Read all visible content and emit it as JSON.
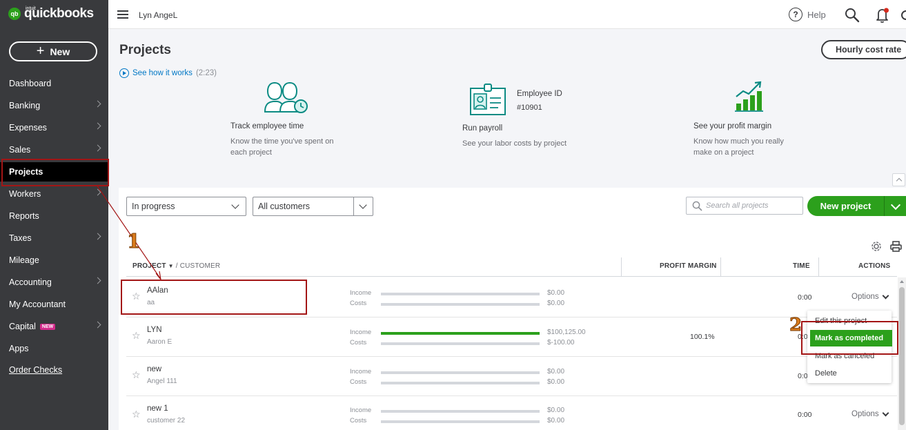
{
  "brand": {
    "intuit": "intuit",
    "name": "quickbooks",
    "mark": "qb"
  },
  "sidebar": {
    "new_label": "New",
    "items": [
      {
        "label": "Dashboard",
        "chevron": false
      },
      {
        "label": "Banking",
        "chevron": true
      },
      {
        "label": "Expenses",
        "chevron": true
      },
      {
        "label": "Sales",
        "chevron": true
      },
      {
        "label": "Projects",
        "chevron": false,
        "active": true
      },
      {
        "label": "Workers",
        "chevron": true
      },
      {
        "label": "Reports",
        "chevron": false
      },
      {
        "label": "Taxes",
        "chevron": true
      },
      {
        "label": "Mileage",
        "chevron": false
      },
      {
        "label": "Accounting",
        "chevron": true
      },
      {
        "label": "My Accountant",
        "chevron": false
      },
      {
        "label": "Capital",
        "chevron": true,
        "badge": "NEW"
      },
      {
        "label": "Apps",
        "chevron": false
      },
      {
        "label": "Order Checks",
        "chevron": false
      }
    ]
  },
  "header": {
    "company": "Lyn AngeL",
    "help": "Help"
  },
  "page": {
    "title": "Projects",
    "hourly_button": "Hourly cost rate",
    "see_how": "See how it works",
    "see_how_duration": "(2:23)"
  },
  "features": {
    "track": {
      "title": "Track employee time",
      "desc1": "Know the time you've spent on",
      "desc2": "each project"
    },
    "payroll": {
      "title": "Run payroll",
      "desc": "See your labor costs by project",
      "badge_label": "Employee ID",
      "badge_value": "#10901"
    },
    "profit": {
      "title": "See your profit margin",
      "desc1": "Know how much you really",
      "desc2": "make on a project"
    }
  },
  "filters": {
    "status": "In progress",
    "customers": "All customers",
    "search_placeholder": "Search all projects",
    "new_project": "New project"
  },
  "table": {
    "headers": {
      "project": "PROJECT",
      "customer": "/ CUSTOMER",
      "margin": "PROFIT MARGIN",
      "time": "TIME",
      "actions": "ACTIONS"
    },
    "income_label": "Income",
    "costs_label": "Costs",
    "options_label": "Options",
    "rows": [
      {
        "name": "AAlan",
        "customer": "aa",
        "income": "$0.00",
        "costs": "$0.00",
        "income_fill": 0,
        "margin": "",
        "time": "0:00"
      },
      {
        "name": "LYN",
        "customer": "Aaron E",
        "income": "$100,125.00",
        "costs": "$-100.00",
        "income_fill": 1,
        "margin": "100.1%",
        "time": "0:00"
      },
      {
        "name": "new",
        "customer": "Angel 111",
        "income": "$0.00",
        "costs": "$0.00",
        "income_fill": 0,
        "margin": "",
        "time": "0:00"
      },
      {
        "name": "new 1",
        "customer": "customer 22",
        "income": "$0.00",
        "costs": "$0.00",
        "income_fill": 0,
        "margin": "",
        "time": "0:00"
      }
    ]
  },
  "menu": [
    "Edit this project",
    "Mark as completed",
    "Mark as canceled",
    "Delete"
  ],
  "annotations": {
    "step1": "1",
    "step2": "2"
  },
  "colors": {
    "accent_green": "#2ca01c",
    "link_blue": "#0077c5",
    "sidebar_bg": "#393a3d",
    "annotation_red": "#a31515"
  }
}
